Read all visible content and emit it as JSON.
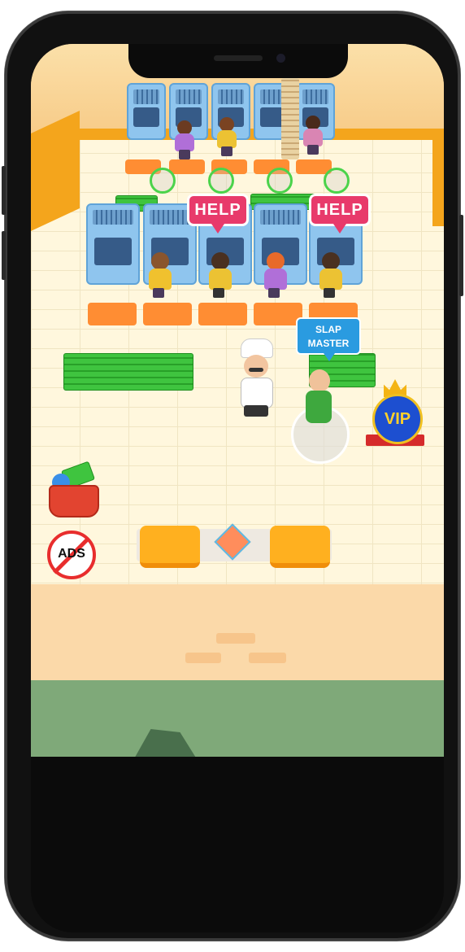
{
  "game": {
    "help_bubble_1": "HELP",
    "help_bubble_2": "HELP",
    "slap_master_line1": "SLAP",
    "slap_master_line2": "MASTER",
    "vip_label": "VIP",
    "ads_label": "ADS"
  },
  "icons": {
    "shop": "cash-basket-icon",
    "no_ads": "no-ads-icon",
    "vip": "vip-crown-icon"
  },
  "colors": {
    "help": "#e83a6b",
    "slap_master": "#2a9be0",
    "cash": "#3fc43f",
    "floor": "#fff7dd",
    "wall_trim": "#f4a51c",
    "grass": "#7fa979"
  }
}
